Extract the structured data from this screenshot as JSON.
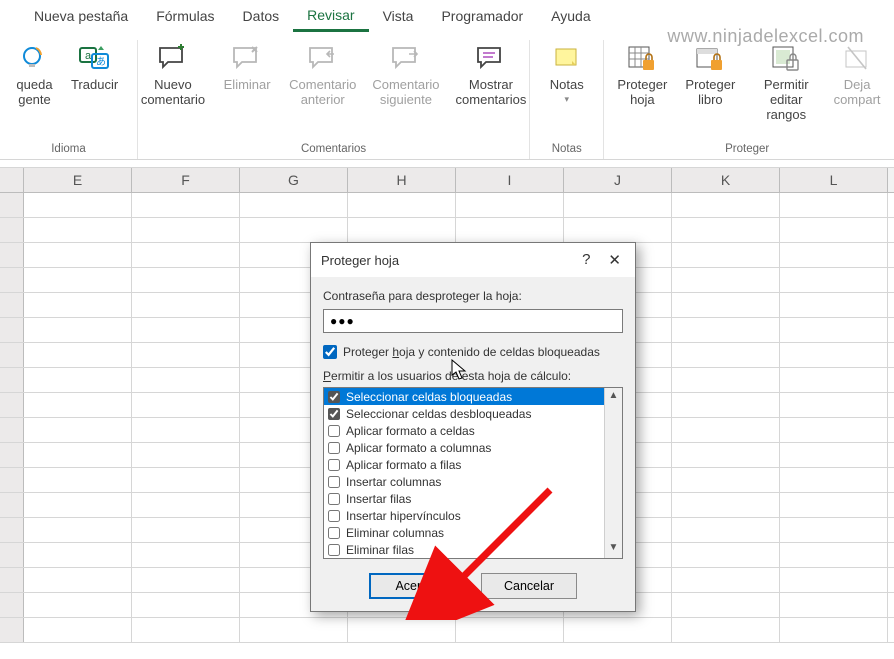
{
  "watermark": "www.ninjadelexcel.com",
  "tabs": [
    "Nueva pestaña",
    "Fórmulas",
    "Datos",
    "Revisar",
    "Vista",
    "Programador",
    "Ayuda"
  ],
  "active_tab_index": 3,
  "ribbon": {
    "group_idioma": {
      "label": "Idioma",
      "btn_bqueda_gente": "queda\ngente",
      "btn_traducir": "Traducir"
    },
    "group_comentarios": {
      "label": "Comentarios",
      "btn_nuevo": "Nuevo\ncomentario",
      "btn_eliminar": "Eliminar",
      "btn_anterior": "Comentario\nanterior",
      "btn_siguiente": "Comentario\nsiguiente",
      "btn_mostrar": "Mostrar\ncomentarios"
    },
    "group_notas": {
      "label": "Notas",
      "btn_notas": "Notas"
    },
    "group_proteger": {
      "label": "Proteger",
      "btn_proteger_hoja": "Proteger\nhoja",
      "btn_proteger_libro": "Proteger\nlibro",
      "btn_permitir": "Permitir\neditar rangos",
      "btn_dejar": "Deja\ncompart"
    }
  },
  "columns": [
    "E",
    "F",
    "G",
    "H",
    "I",
    "J",
    "K",
    "L"
  ],
  "dialog": {
    "title": "Proteger hoja",
    "help": "?",
    "close": "✕",
    "pwd_label": "Contraseña para desproteger la hoja:",
    "pwd_value": "●●●",
    "protect_chk_label_pre": "Proteger ",
    "protect_chk_label_u": "h",
    "protect_chk_label_post": "oja y contenido de celdas bloqueadas",
    "perm_label_pre": "",
    "perm_label_u": "P",
    "perm_label_post": "ermitir a los usuarios de esta hoja de cálculo:",
    "permissions": [
      {
        "label": "Seleccionar celdas bloqueadas",
        "checked": true,
        "selected": true
      },
      {
        "label": "Seleccionar celdas desbloqueadas",
        "checked": true
      },
      {
        "label": "Aplicar formato a celdas",
        "checked": false
      },
      {
        "label": "Aplicar formato a columnas",
        "checked": false
      },
      {
        "label": "Aplicar formato a filas",
        "checked": false
      },
      {
        "label": "Insertar columnas",
        "checked": false
      },
      {
        "label": "Insertar filas",
        "checked": false
      },
      {
        "label": "Insertar hipervínculos",
        "checked": false
      },
      {
        "label": "Eliminar columnas",
        "checked": false
      },
      {
        "label": "Eliminar filas",
        "checked": false
      }
    ],
    "btn_ok": "Aceptar",
    "btn_cancel": "Cancelar"
  }
}
